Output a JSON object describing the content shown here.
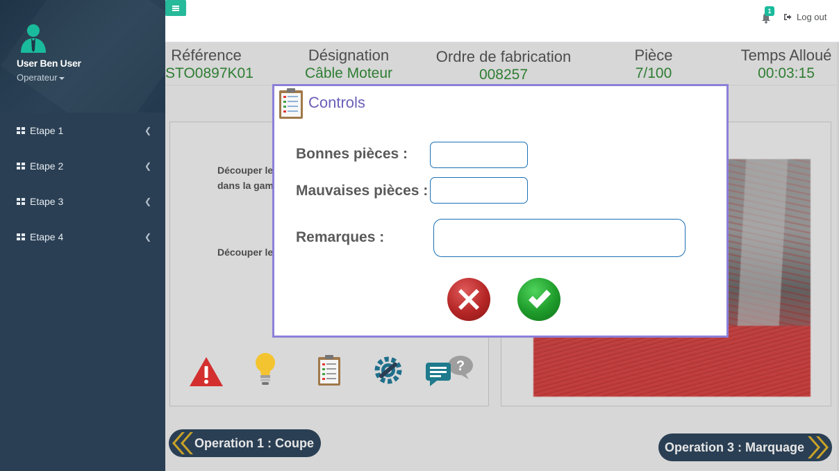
{
  "sidebar": {
    "user_name": "User Ben User",
    "user_role": "Operateur",
    "items": [
      {
        "label": "Etape 1",
        "icon": "grid-icon"
      },
      {
        "label": "Etape 2",
        "icon": "grid-icon"
      },
      {
        "label": "Etape 3",
        "icon": "grid-icon"
      },
      {
        "label": "Etape 4",
        "icon": "grid-icon"
      }
    ]
  },
  "topbar": {
    "notification_count": "1",
    "logout_label": "Log out"
  },
  "info": {
    "reference": {
      "label": "Référence",
      "value": "STO0897K01"
    },
    "designation": {
      "label": "Désignation",
      "value": "Câble Moteur"
    },
    "ordre": {
      "label": "Ordre de fabrication",
      "value": "008257"
    },
    "piece": {
      "label": "Pièce",
      "value": "7/100"
    },
    "temps": {
      "label": "Temps Alloué",
      "value": "00:03:15"
    }
  },
  "instructions": {
    "line1a": "Découper le",
    "line1b": "dans la gam",
    "line2": "Découper le"
  },
  "operations": {
    "prev": "Operation 1 : Coupe",
    "next": "Operation 3 : Marquage"
  },
  "modal": {
    "title": "Controls",
    "bonnes_label": "Bonnes pièces :",
    "bonnes_value": "",
    "mauvaises_label": "Mauvaises pièces :",
    "mauvaises_value": "",
    "remarques_label": "Remarques :",
    "remarques_value": ""
  },
  "colors": {
    "sidebar": "#2a3f54",
    "accent": "#26b99a",
    "value_green": "#2e7d32",
    "modal_border": "#8b80d9",
    "modal_title": "#6a5fb8"
  }
}
